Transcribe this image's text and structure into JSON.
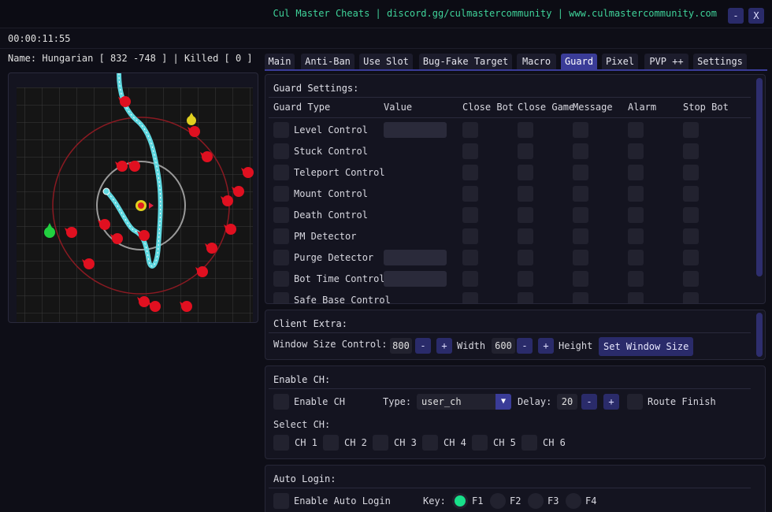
{
  "window": {
    "title": "Cul Master Cheats | discord.gg/culmastercommunity | www.culmastercommunity.com",
    "minimize_label": "-",
    "close_label": "X"
  },
  "timer": "00:00:11:55",
  "status": {
    "text": "Name: Hungarian [ 832 -748 ] | Killed [ 0 ]"
  },
  "tabs": [
    "Main",
    "Anti-Ban",
    "Use Slot",
    "Bug-Fake Target",
    "Macro",
    "Guard",
    "Pixel",
    "PVP ++",
    "Settings"
  ],
  "active_tab": "Guard",
  "guard": {
    "section_title": "Guard Settings:",
    "headers": [
      "Guard Type",
      "Value",
      "Close Bot",
      "Close Game",
      "Message",
      "Alarm",
      "Stop Bot"
    ],
    "rows": [
      {
        "label": "Level Control",
        "has_value": true
      },
      {
        "label": "Stuck Control",
        "has_value": false
      },
      {
        "label": "Teleport Control",
        "has_value": false
      },
      {
        "label": "Mount Control",
        "has_value": false
      },
      {
        "label": "Death Control",
        "has_value": false
      },
      {
        "label": "PM Detector",
        "has_value": false
      },
      {
        "label": "Purge Detector",
        "has_value": true
      },
      {
        "label": "Bot Time Control",
        "has_value": true
      },
      {
        "label": "Safe Base Control",
        "has_value": false
      }
    ]
  },
  "client_extra": {
    "section_title": "Client Extra:",
    "window_size_label": "Window Size Control:",
    "width_value": "800",
    "width_label": "Width",
    "height_value": "600",
    "height_label": "Height",
    "minus": "-",
    "plus": "+",
    "set_button": "Set Window Size"
  },
  "enable_ch": {
    "section_title": "Enable CH:",
    "enable_label": "Enable CH",
    "type_label": "Type:",
    "type_value": "user_ch",
    "delay_label": "Delay:",
    "delay_value": "20",
    "route_finish_label": "Route Finish",
    "select_label": "Select CH:",
    "channels": [
      "CH 1",
      "CH 2",
      "CH 3",
      "CH 4",
      "CH 5",
      "CH 6"
    ]
  },
  "auto_login": {
    "section_title": "Auto Login:",
    "enable_label": "Enable Auto Login",
    "key_label": "Key:",
    "keys": [
      "F1",
      "F2",
      "F3",
      "F4"
    ],
    "selected_key": "F1"
  },
  "colors": {
    "accent": "#3a3c98",
    "title_green": "#3fd39a",
    "path_cyan": "#5fd8e0",
    "enemy_red": "#e01020",
    "range_circle": "#8a1a22",
    "player_green": "#22d040",
    "player_yellow": "#e0d020"
  },
  "icons": {
    "key_radio_selected": "filled-green-dot",
    "type_dropdown": "triangle-down-icon"
  }
}
